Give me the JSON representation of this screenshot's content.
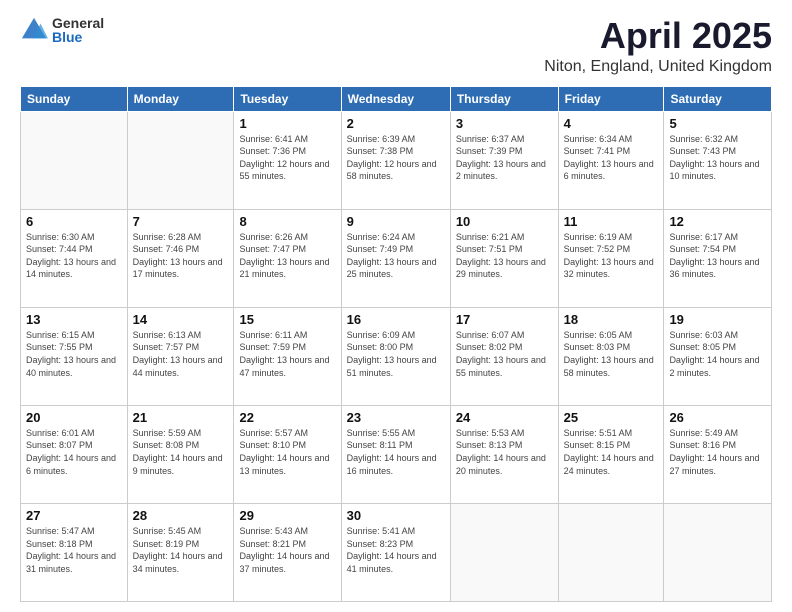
{
  "logo": {
    "general": "General",
    "blue": "Blue"
  },
  "title": "April 2025",
  "subtitle": "Niton, England, United Kingdom",
  "headers": [
    "Sunday",
    "Monday",
    "Tuesday",
    "Wednesday",
    "Thursday",
    "Friday",
    "Saturday"
  ],
  "weeks": [
    [
      {
        "day": "",
        "sunrise": "",
        "sunset": "",
        "daylight": ""
      },
      {
        "day": "",
        "sunrise": "",
        "sunset": "",
        "daylight": ""
      },
      {
        "day": "1",
        "sunrise": "Sunrise: 6:41 AM",
        "sunset": "Sunset: 7:36 PM",
        "daylight": "Daylight: 12 hours and 55 minutes."
      },
      {
        "day": "2",
        "sunrise": "Sunrise: 6:39 AM",
        "sunset": "Sunset: 7:38 PM",
        "daylight": "Daylight: 12 hours and 58 minutes."
      },
      {
        "day": "3",
        "sunrise": "Sunrise: 6:37 AM",
        "sunset": "Sunset: 7:39 PM",
        "daylight": "Daylight: 13 hours and 2 minutes."
      },
      {
        "day": "4",
        "sunrise": "Sunrise: 6:34 AM",
        "sunset": "Sunset: 7:41 PM",
        "daylight": "Daylight: 13 hours and 6 minutes."
      },
      {
        "day": "5",
        "sunrise": "Sunrise: 6:32 AM",
        "sunset": "Sunset: 7:43 PM",
        "daylight": "Daylight: 13 hours and 10 minutes."
      }
    ],
    [
      {
        "day": "6",
        "sunrise": "Sunrise: 6:30 AM",
        "sunset": "Sunset: 7:44 PM",
        "daylight": "Daylight: 13 hours and 14 minutes."
      },
      {
        "day": "7",
        "sunrise": "Sunrise: 6:28 AM",
        "sunset": "Sunset: 7:46 PM",
        "daylight": "Daylight: 13 hours and 17 minutes."
      },
      {
        "day": "8",
        "sunrise": "Sunrise: 6:26 AM",
        "sunset": "Sunset: 7:47 PM",
        "daylight": "Daylight: 13 hours and 21 minutes."
      },
      {
        "day": "9",
        "sunrise": "Sunrise: 6:24 AM",
        "sunset": "Sunset: 7:49 PM",
        "daylight": "Daylight: 13 hours and 25 minutes."
      },
      {
        "day": "10",
        "sunrise": "Sunrise: 6:21 AM",
        "sunset": "Sunset: 7:51 PM",
        "daylight": "Daylight: 13 hours and 29 minutes."
      },
      {
        "day": "11",
        "sunrise": "Sunrise: 6:19 AM",
        "sunset": "Sunset: 7:52 PM",
        "daylight": "Daylight: 13 hours and 32 minutes."
      },
      {
        "day": "12",
        "sunrise": "Sunrise: 6:17 AM",
        "sunset": "Sunset: 7:54 PM",
        "daylight": "Daylight: 13 hours and 36 minutes."
      }
    ],
    [
      {
        "day": "13",
        "sunrise": "Sunrise: 6:15 AM",
        "sunset": "Sunset: 7:55 PM",
        "daylight": "Daylight: 13 hours and 40 minutes."
      },
      {
        "day": "14",
        "sunrise": "Sunrise: 6:13 AM",
        "sunset": "Sunset: 7:57 PM",
        "daylight": "Daylight: 13 hours and 44 minutes."
      },
      {
        "day": "15",
        "sunrise": "Sunrise: 6:11 AM",
        "sunset": "Sunset: 7:59 PM",
        "daylight": "Daylight: 13 hours and 47 minutes."
      },
      {
        "day": "16",
        "sunrise": "Sunrise: 6:09 AM",
        "sunset": "Sunset: 8:00 PM",
        "daylight": "Daylight: 13 hours and 51 minutes."
      },
      {
        "day": "17",
        "sunrise": "Sunrise: 6:07 AM",
        "sunset": "Sunset: 8:02 PM",
        "daylight": "Daylight: 13 hours and 55 minutes."
      },
      {
        "day": "18",
        "sunrise": "Sunrise: 6:05 AM",
        "sunset": "Sunset: 8:03 PM",
        "daylight": "Daylight: 13 hours and 58 minutes."
      },
      {
        "day": "19",
        "sunrise": "Sunrise: 6:03 AM",
        "sunset": "Sunset: 8:05 PM",
        "daylight": "Daylight: 14 hours and 2 minutes."
      }
    ],
    [
      {
        "day": "20",
        "sunrise": "Sunrise: 6:01 AM",
        "sunset": "Sunset: 8:07 PM",
        "daylight": "Daylight: 14 hours and 6 minutes."
      },
      {
        "day": "21",
        "sunrise": "Sunrise: 5:59 AM",
        "sunset": "Sunset: 8:08 PM",
        "daylight": "Daylight: 14 hours and 9 minutes."
      },
      {
        "day": "22",
        "sunrise": "Sunrise: 5:57 AM",
        "sunset": "Sunset: 8:10 PM",
        "daylight": "Daylight: 14 hours and 13 minutes."
      },
      {
        "day": "23",
        "sunrise": "Sunrise: 5:55 AM",
        "sunset": "Sunset: 8:11 PM",
        "daylight": "Daylight: 14 hours and 16 minutes."
      },
      {
        "day": "24",
        "sunrise": "Sunrise: 5:53 AM",
        "sunset": "Sunset: 8:13 PM",
        "daylight": "Daylight: 14 hours and 20 minutes."
      },
      {
        "day": "25",
        "sunrise": "Sunrise: 5:51 AM",
        "sunset": "Sunset: 8:15 PM",
        "daylight": "Daylight: 14 hours and 24 minutes."
      },
      {
        "day": "26",
        "sunrise": "Sunrise: 5:49 AM",
        "sunset": "Sunset: 8:16 PM",
        "daylight": "Daylight: 14 hours and 27 minutes."
      }
    ],
    [
      {
        "day": "27",
        "sunrise": "Sunrise: 5:47 AM",
        "sunset": "Sunset: 8:18 PM",
        "daylight": "Daylight: 14 hours and 31 minutes."
      },
      {
        "day": "28",
        "sunrise": "Sunrise: 5:45 AM",
        "sunset": "Sunset: 8:19 PM",
        "daylight": "Daylight: 14 hours and 34 minutes."
      },
      {
        "day": "29",
        "sunrise": "Sunrise: 5:43 AM",
        "sunset": "Sunset: 8:21 PM",
        "daylight": "Daylight: 14 hours and 37 minutes."
      },
      {
        "day": "30",
        "sunrise": "Sunrise: 5:41 AM",
        "sunset": "Sunset: 8:23 PM",
        "daylight": "Daylight: 14 hours and 41 minutes."
      },
      {
        "day": "",
        "sunrise": "",
        "sunset": "",
        "daylight": ""
      },
      {
        "day": "",
        "sunrise": "",
        "sunset": "",
        "daylight": ""
      },
      {
        "day": "",
        "sunrise": "",
        "sunset": "",
        "daylight": ""
      }
    ]
  ]
}
